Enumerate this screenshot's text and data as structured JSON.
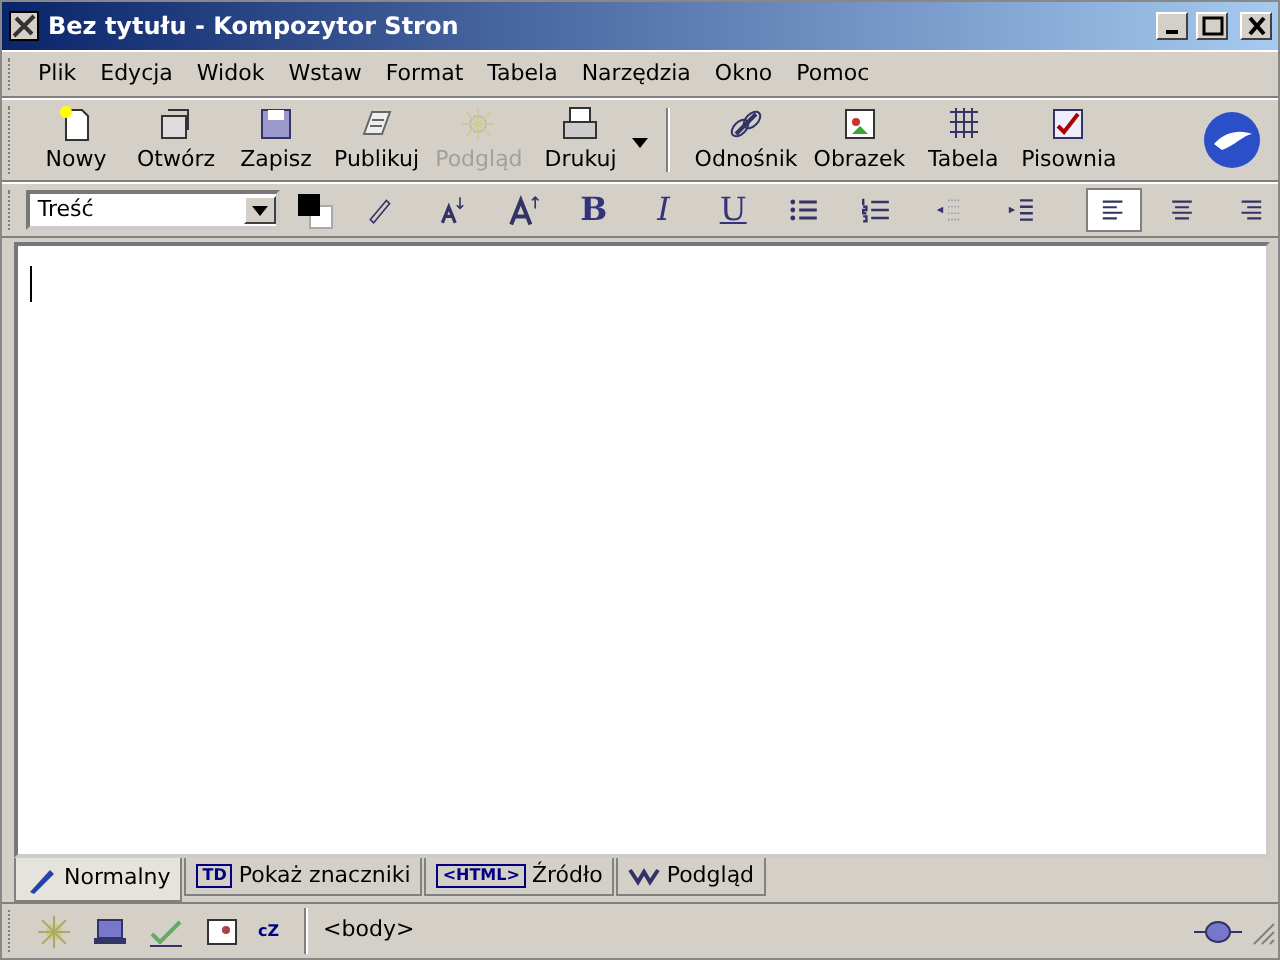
{
  "window": {
    "title": "Bez tytułu - Kompozytor Stron"
  },
  "menu": [
    {
      "label": "Plik"
    },
    {
      "label": "Edycja"
    },
    {
      "label": "Widok"
    },
    {
      "label": "Wstaw"
    },
    {
      "label": "Format"
    },
    {
      "label": "Tabela"
    },
    {
      "label": "Narzędzia"
    },
    {
      "label": "Okno"
    },
    {
      "label": "Pomoc"
    }
  ],
  "toolbar": [
    {
      "label": "Nowy",
      "disabled": false
    },
    {
      "label": "Otwórz",
      "disabled": false
    },
    {
      "label": "Zapisz",
      "disabled": false
    },
    {
      "label": "Publikuj",
      "disabled": false
    },
    {
      "label": "Podgląd",
      "disabled": true
    },
    {
      "label": "Drukuj",
      "disabled": false
    },
    {
      "label": "Odnośnik",
      "disabled": false
    },
    {
      "label": "Obrazek",
      "disabled": false
    },
    {
      "label": "Tabela",
      "disabled": false
    },
    {
      "label": "Pisownia",
      "disabled": false
    }
  ],
  "format_bar": {
    "paragraph_style": "Treść",
    "bold": "B",
    "italic": "I",
    "underline": "U",
    "alignments": [
      {
        "selected": true
      },
      {
        "selected": false
      },
      {
        "selected": false
      }
    ]
  },
  "view_tabs": [
    {
      "label": "Normalny",
      "selected": true
    },
    {
      "badge": "TD",
      "label": "Pokaż znaczniki",
      "selected": false
    },
    {
      "badge": "<HTML>",
      "label": "Źródło",
      "selected": false
    },
    {
      "label": "Podgląd",
      "selected": false
    }
  ],
  "status_bar": {
    "icon_text": "cZ",
    "tag": "<body>"
  }
}
